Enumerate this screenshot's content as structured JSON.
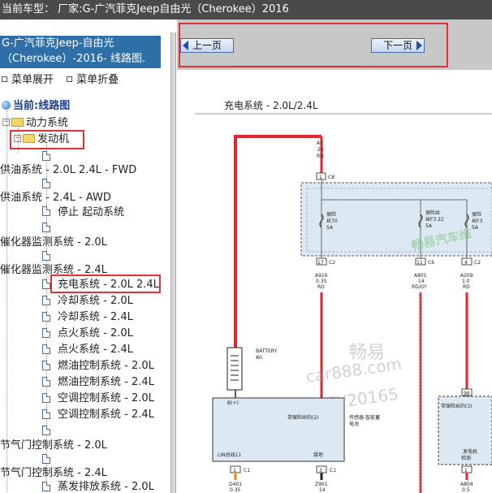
{
  "header": {
    "title": "当前车型： 厂家:G-广汽菲克Jeep自由光（Cherokee）2016"
  },
  "sidebar": {
    "title_line1": "G-广汽菲克Jeep-自由光",
    "title_line2": "（Cherokee）-2016- 线路图.",
    "expand_label": "菜单展开",
    "collapse_label": "菜单折叠",
    "root": "当前:线路图",
    "group_power": "动力系统",
    "group_engine": "发动机",
    "items": [
      "供油系统 - 2.0L 2.4L - FWD",
      "供油系统 - 2.4L - AWD",
      "停止 起动系统",
      "催化器监测系统 - 2.0L",
      "催化器监测系统 - 2.4L",
      "充电系统 - 2.0L 2.4L",
      "冷却系统 - 2.0L",
      "冷却系统 - 2.4L",
      "点火系统 - 2.0L",
      "点火系统 - 2.4L",
      "燃油控制系统 - 2.0L",
      "燃油控制系统 - 2.4L",
      "空调控制系统 - 2.0L",
      "空调控制系统 - 2.4L",
      "节气门控制系统 - 2.0L",
      "节气门控制系统 - 2.4L",
      "蒸发排放系统 - 2.0L"
    ]
  },
  "nav": {
    "prev_label": "上一页",
    "next_label": "下一页"
  },
  "diagram": {
    "title": "充电系统 - 2.0L/2.4L",
    "wire_a0": "A0",
    "wire_a0_gauge": "25",
    "wire_a0_color": "RD",
    "pin1": "1",
    "conn_c8": "C8",
    "fuse70": "保险",
    "fuse70_b": "丝70",
    "fuse70_c": "5A",
    "fuse_f322": "保险丝",
    "fuse_f322_b": "丝F3 22",
    "fuse_f322_c": "5A",
    "fuse_f3": "保险",
    "fuse_f3_b": "丝F3",
    "fuse_f3_c": "5A",
    "pin17": "17",
    "conn_c2a": "C2",
    "pin11": "11",
    "conn_c6": "C6",
    "pin4": "4",
    "conn_c2b": "C2",
    "w_a916": "A916",
    "w_a916_g": "0.35",
    "w_a916_c": "RD",
    "w_a801": "A801",
    "w_a801_g": "14",
    "w_a801_c": "RD/GY",
    "w_a209": "A209",
    "w_a209_g": "1.0",
    "w_a209_c": "RD",
    "battery": "BATTERY",
    "battery_b": "A0",
    "b_plus": "B(+)",
    "pin2": "2",
    "conn_c1a": "C1",
    "fused_label": "带保险丝的(2)",
    "sensor_label": "传感器-智能蓄",
    "sensor_label_b": "电池",
    "lin_label": "LIN总线11",
    "ground_label": "接地",
    "pin96": "96",
    "fused_label_r": "带保险丝的(3)",
    "gen_label": "发电机",
    "gen_label_b": "检测",
    "pin1b": "1",
    "conn_c1b": "C1",
    "pin3": "3",
    "conn_c1c": "C1",
    "pin1c": "1",
    "w_d401": "D401",
    "w_d401_g": "0.35",
    "w_z901": "Z901",
    "w_z901_g": "14",
    "w_a804": "A804",
    "w_a804_g": "0.5",
    "watermark_1": "畅易汽车维",
    "watermark_2": "畅易",
    "watermark_3": "car888.com",
    "watermark_4": "CY20165"
  }
}
